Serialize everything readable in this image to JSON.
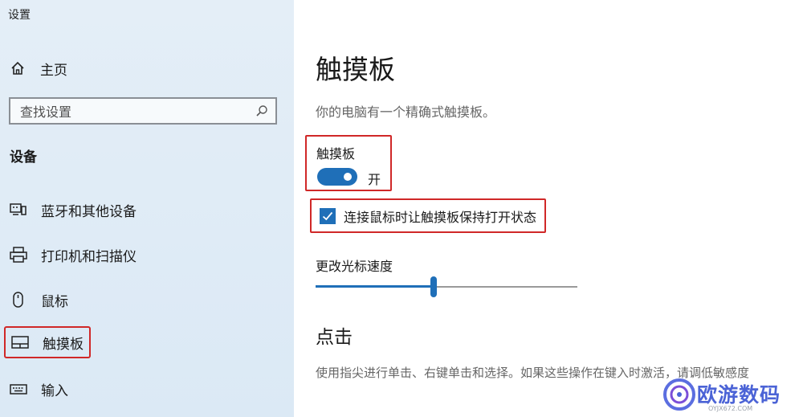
{
  "window": {
    "title": "设置"
  },
  "sidebar": {
    "home_label": "主页",
    "search_placeholder": "查找设置",
    "section_label": "设备",
    "items": [
      {
        "label": "蓝牙和其他设备",
        "icon": "bluetooth-devices-icon"
      },
      {
        "label": "打印机和扫描仪",
        "icon": "printer-icon"
      },
      {
        "label": "鼠标",
        "icon": "mouse-icon"
      },
      {
        "label": "触摸板",
        "icon": "touchpad-icon",
        "selected": true
      },
      {
        "label": "输入",
        "icon": "keyboard-icon"
      }
    ]
  },
  "main": {
    "title": "触摸板",
    "description": "你的电脑有一个精确式触摸板。",
    "touchpad_setting": {
      "label": "触摸板",
      "state_text": "开",
      "on": true
    },
    "keep_on_checkbox": {
      "label": "连接鼠标时让触摸板保持打开状态",
      "checked": true
    },
    "cursor_speed": {
      "label": "更改光标速度",
      "value_fraction": 0.45
    },
    "click_section": {
      "title": "点击",
      "description": "使用指尖进行单击、右键单击和选择。如果这些操作在键入时激活，请调低敏感度"
    }
  },
  "watermark": {
    "text": "欧游数码",
    "subtext": "OYJX672.COM"
  },
  "colors": {
    "accent": "#1f6fb8",
    "highlight_border": "#d02828",
    "sidebar_bg": "#dfebf6"
  }
}
